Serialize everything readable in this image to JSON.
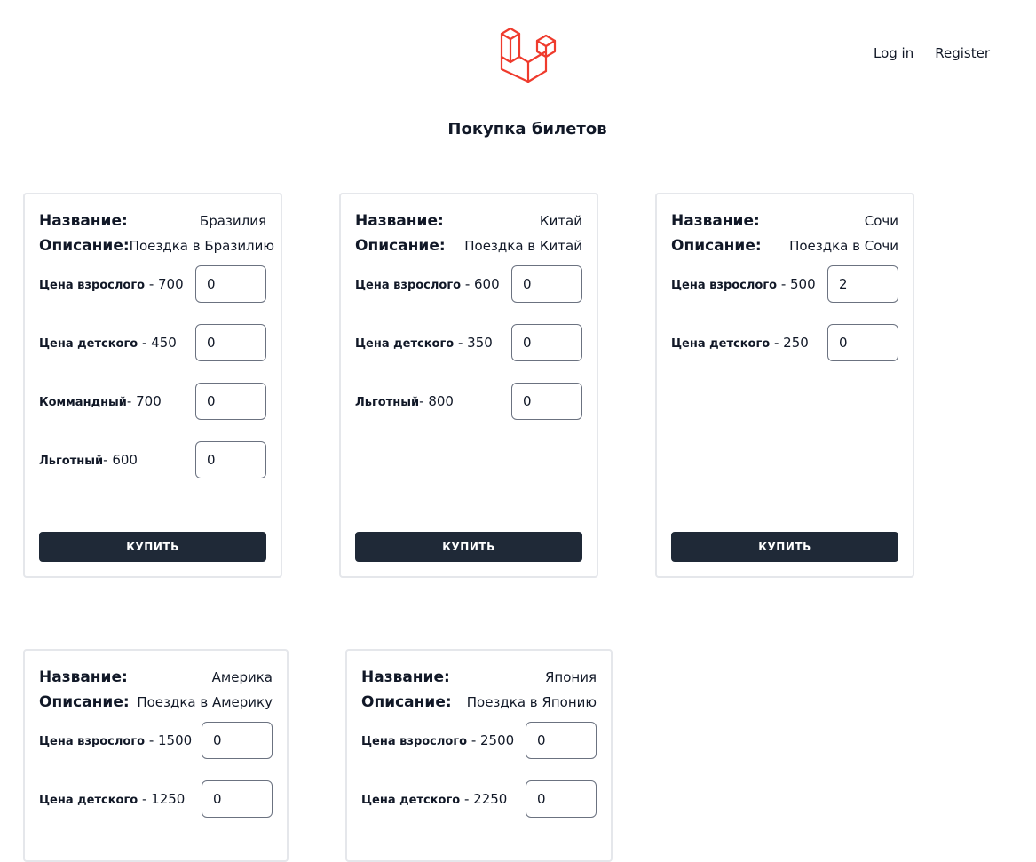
{
  "nav": {
    "login": "Log in",
    "register": "Register"
  },
  "page": {
    "title": "Покупка билетов"
  },
  "labels": {
    "name": "Название",
    "description": "Описание",
    "buy": "КУПИТЬ"
  },
  "tours": [
    {
      "name": "Бразилия",
      "description": "Поездка в Бразилию",
      "prices": [
        {
          "label": "Цена взрослого",
          "sep": " - ",
          "price": "700",
          "qty": "0"
        },
        {
          "label": "Цена детского",
          "sep": " - ",
          "price": "450",
          "qty": "0"
        },
        {
          "label": "Коммандный",
          "sep": "- ",
          "price": "700",
          "qty": "0"
        },
        {
          "label": "Льготный",
          "sep": "- ",
          "price": "600",
          "qty": "0"
        }
      ]
    },
    {
      "name": "Китай",
      "description": "Поездка в Китай",
      "prices": [
        {
          "label": "Цена взрослого",
          "sep": " - ",
          "price": "600",
          "qty": "0"
        },
        {
          "label": "Цена детского",
          "sep": " - ",
          "price": "350",
          "qty": "0"
        },
        {
          "label": "Льготный",
          "sep": "- ",
          "price": "800",
          "qty": "0"
        }
      ]
    },
    {
      "name": "Сочи",
      "description": "Поездка в Сочи",
      "prices": [
        {
          "label": "Цена взрослого",
          "sep": " - ",
          "price": "500",
          "qty": "2"
        },
        {
          "label": "Цена детского",
          "sep": " - ",
          "price": "250",
          "qty": "0"
        }
      ]
    },
    {
      "name": "Америка",
      "description": "Поездка в Америку",
      "prices": [
        {
          "label": "Цена взрослого",
          "sep": " - ",
          "price": "1500",
          "qty": "0"
        },
        {
          "label": "Цена детского",
          "sep": " - ",
          "price": "1250",
          "qty": "0"
        }
      ]
    },
    {
      "name": "Япония",
      "description": "Поездка в Японию",
      "prices": [
        {
          "label": "Цена взрослого",
          "sep": " - ",
          "price": "2500",
          "qty": "0"
        },
        {
          "label": "Цена детского",
          "sep": " - ",
          "price": "2250",
          "qty": "0"
        }
      ]
    }
  ]
}
